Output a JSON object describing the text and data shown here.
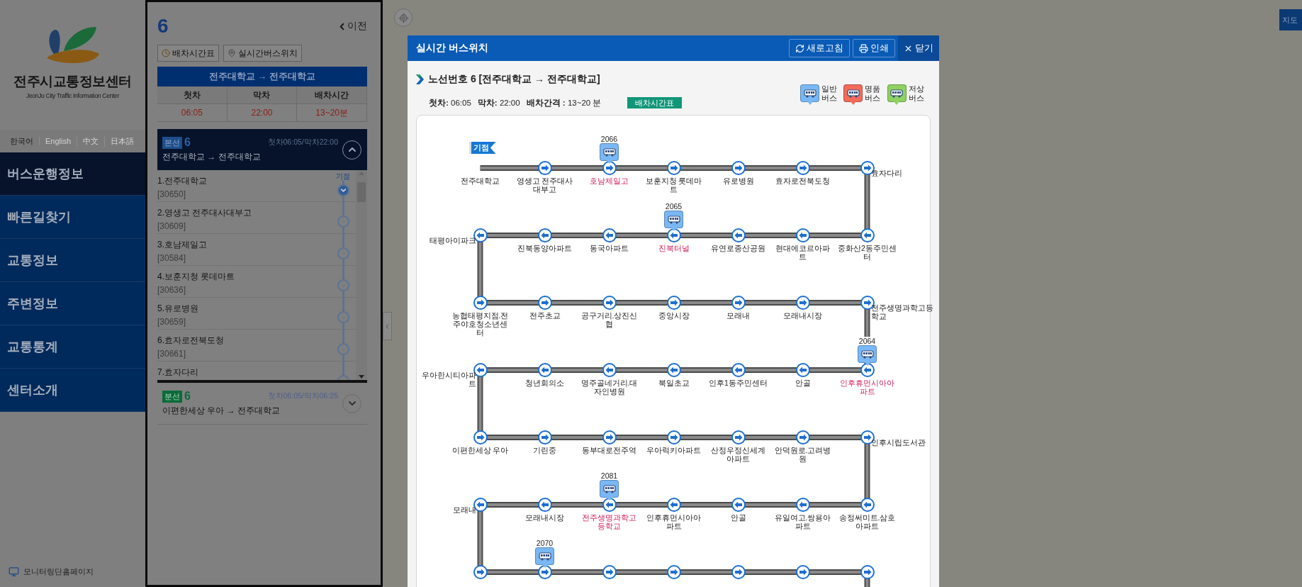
{
  "sidebar": {
    "logo_title": "전주시교통정보센터",
    "logo_subtitle": "JeonJu City Traffic Information Center",
    "languages": [
      {
        "label": "한국어",
        "selected": true
      },
      {
        "label": "English",
        "selected": false
      },
      {
        "label": "中文",
        "selected": false
      },
      {
        "label": "日本語",
        "selected": false
      }
    ],
    "menu": [
      {
        "label": "버스운행정보",
        "selected": true
      },
      {
        "label": "빠른길찾기",
        "selected": false
      },
      {
        "label": "교통정보",
        "selected": false
      },
      {
        "label": "주변정보",
        "selected": false
      },
      {
        "label": "교통통계",
        "selected": false
      },
      {
        "label": "센터소개",
        "selected": false
      }
    ],
    "footer_link": "모니터링단홈페이지"
  },
  "route_panel": {
    "route_number": "6",
    "back": "이전",
    "buttons": [
      {
        "kind": "clock",
        "label": "배차시간표"
      },
      {
        "kind": "pin",
        "label": "실시간버스위치"
      }
    ],
    "direction": "전주대학교 → 전주대학교",
    "table": {
      "columns": [
        "첫차",
        "막차",
        "배차시간"
      ],
      "values": [
        "06:05",
        "22:00",
        "13~20분"
      ]
    },
    "lines": [
      {
        "kind": "main",
        "badge": "본선",
        "number": "6",
        "times": "첫차06:05/막차22:00",
        "route": "전주대학교 → 전주대학교",
        "expanded": true,
        "stops": [
          {
            "name": "1.전주대학교",
            "code": "[30650]",
            "tag": "기점"
          },
          {
            "name": "2.영생고 전주대사대부고",
            "code": "[30609]"
          },
          {
            "name": "3.호남제일고",
            "code": "[30584]"
          },
          {
            "name": "4.보훈지청 롯데마트",
            "code": "[30636]"
          },
          {
            "name": "5.유로병원",
            "code": "[30659]"
          },
          {
            "name": "6.효자로전북도청",
            "code": "[30661]"
          },
          {
            "name": "7.효자다리"
          }
        ]
      },
      {
        "kind": "branch",
        "badge": "분선",
        "number": "6",
        "times": "첫차06:05/막차06:25",
        "route": "이편한세상 우아 → 전주대학교",
        "expanded": false
      }
    ]
  },
  "map": {
    "map_button": "지도"
  },
  "modal": {
    "title": "실시간 버스위치",
    "actions": [
      {
        "kind": "refresh",
        "label": "새로고침"
      },
      {
        "kind": "print",
        "label": "인쇄"
      },
      {
        "kind": "close",
        "label": "닫기"
      }
    ],
    "route_title": "노선번호 6 [전주대학교 → 전주대학교]",
    "legend": [
      {
        "label": "일반 버스",
        "color": "#7ab8f5"
      },
      {
        "label": "명품 버스",
        "color": "#f26b5b"
      },
      {
        "label": "저상 버스",
        "color": "#8fd162"
      }
    ],
    "info": [
      {
        "label": "첫차:",
        "value": "06:05"
      },
      {
        "label": "막차:",
        "value": "22:00"
      },
      {
        "label": "배차간격 :",
        "value": "13~20 분"
      }
    ],
    "timetable_button": "배차시간표",
    "start_flag": "기점",
    "rows": [
      {
        "stops": [
          {
            "kind": "start",
            "name": "전주대학교",
            "current": false
          },
          {
            "kind": "stop",
            "name": "영생고 전주대사대부고",
            "current": false
          },
          {
            "kind": "stop",
            "name": "호남제일고",
            "current": true,
            "bus": "2066"
          },
          {
            "kind": "stop",
            "name": "보훈지청 롯데마트",
            "current": false
          },
          {
            "kind": "stop",
            "name": "유로병원",
            "current": false
          },
          {
            "kind": "stop",
            "name": "효자로전북도청",
            "current": false
          },
          {
            "kind": "stop",
            "name": "효자다리",
            "current": false
          }
        ]
      },
      {
        "stops": [
          {
            "kind": "stop",
            "name": "태평아이파크",
            "current": false
          },
          {
            "kind": "stop",
            "name": "진북동양아파트",
            "current": false
          },
          {
            "kind": "stop",
            "name": "동국아파트",
            "current": false
          },
          {
            "kind": "stop",
            "name": "진북터널",
            "current": true,
            "bus": "2065"
          },
          {
            "kind": "stop",
            "name": "유연로종산공원",
            "current": false
          },
          {
            "kind": "stop",
            "name": "현대에코르아파트",
            "current": false
          },
          {
            "kind": "stop",
            "name": "중화산2동주민센터",
            "current": false
          }
        ]
      },
      {
        "stops": [
          {
            "kind": "stop",
            "name": "농협태평지점.전주야호청소년센터",
            "current": false
          },
          {
            "kind": "stop",
            "name": "전주초교",
            "current": false
          },
          {
            "kind": "stop",
            "name": "공구거리.상진신협",
            "current": false
          },
          {
            "kind": "stop",
            "name": "중앙시장",
            "current": false
          },
          {
            "kind": "stop",
            "name": "모래내",
            "current": false
          },
          {
            "kind": "stop",
            "name": "모래내시장",
            "current": false
          },
          {
            "kind": "stop",
            "name": "전주생명과학고등학교",
            "current": false
          }
        ]
      },
      {
        "stops": [
          {
            "kind": "stop",
            "name": "우아한시티아파트",
            "current": false
          },
          {
            "kind": "stop",
            "name": "청년회의소",
            "current": false
          },
          {
            "kind": "stop",
            "name": "명주골네거리.대자인병원",
            "current": false
          },
          {
            "kind": "stop",
            "name": "북일초교",
            "current": false
          },
          {
            "kind": "stop",
            "name": "인후1동주민센터",
            "current": false
          },
          {
            "kind": "stop",
            "name": "안골",
            "current": false
          },
          {
            "kind": "stop",
            "name": "인후휴먼시아아파트",
            "current": true,
            "bus": "2064"
          }
        ]
      },
      {
        "stops": [
          {
            "kind": "stop",
            "name": "이편한세상 우아",
            "current": false
          },
          {
            "kind": "stop",
            "name": "기린중",
            "current": false
          },
          {
            "kind": "stop",
            "name": "동부대로전주역",
            "current": false
          },
          {
            "kind": "stop",
            "name": "우아럭키아파트",
            "current": false
          },
          {
            "kind": "stop",
            "name": "산정우정신세계아파트",
            "current": false
          },
          {
            "kind": "stop",
            "name": "안덕원로.고려병원",
            "current": false
          },
          {
            "kind": "stop",
            "name": "인후시립도서관",
            "current": false
          }
        ]
      },
      {
        "stops": [
          {
            "kind": "stop",
            "name": "모래내",
            "current": false
          },
          {
            "kind": "stop",
            "name": "모래내시장",
            "current": false
          },
          {
            "kind": "stop",
            "name": "전주생명과학고등학교",
            "current": true,
            "bus": "2081"
          },
          {
            "kind": "stop",
            "name": "인후휴먼시아아파트",
            "current": false
          },
          {
            "kind": "stop",
            "name": "안골",
            "current": false
          },
          {
            "kind": "stop",
            "name": "유일여고.쌍용아파트",
            "current": false
          },
          {
            "kind": "stop",
            "name": "송정써미트.삼호아파트",
            "current": false
          }
        ]
      },
      {
        "stops": [
          {
            "kind": "stop"
          },
          {
            "kind": "stop",
            "bus": "2070"
          },
          {
            "kind": "stop"
          },
          {
            "kind": "stop"
          },
          {
            "kind": "stop"
          },
          {
            "kind": "stop"
          },
          {
            "kind": "stop"
          }
        ]
      }
    ]
  }
}
